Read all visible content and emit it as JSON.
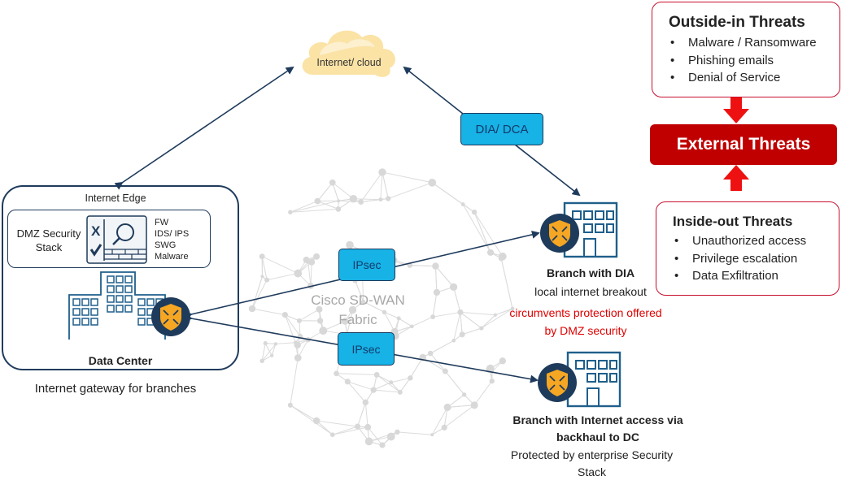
{
  "cloud": {
    "label": "Internet/ cloud"
  },
  "dia_dca": {
    "label": "DIA/ DCA"
  },
  "data_center": {
    "edge_label": "Internet Edge",
    "dmz_label_line1": "DMZ Security",
    "dmz_label_line2": "Stack",
    "stack_items": [
      "FW",
      "IDS/ IPS",
      "SWG",
      "Malware"
    ],
    "title": "Data Center",
    "caption": "Internet gateway for branches"
  },
  "fabric": {
    "line1": "Cisco SD-WAN",
    "line2": "Fabric"
  },
  "tunnels": [
    {
      "label": "IPsec"
    },
    {
      "label": "IPsec"
    }
  ],
  "branch_dia": {
    "title": "Branch with DIA",
    "line1": "local internet breakout",
    "warning_line1": "circumvents protection offered",
    "warning_line2": "by DMZ security"
  },
  "branch_backhaul": {
    "title_line1": "Branch with Internet access via",
    "title_line2": "backhaul to DC",
    "line1": "Protected by enterprise Security",
    "line2": "Stack"
  },
  "threats": {
    "outside_in": {
      "title": "Outside-in Threats",
      "items": [
        "Malware / Ransomware",
        "Phishing emails",
        "Denial of Service"
      ]
    },
    "external": {
      "label": "External Threats"
    },
    "inside_out": {
      "title": "Inside-out Threats",
      "items": [
        "Unauthorized access",
        "Privilege escalation",
        "Data Exfiltration"
      ]
    }
  },
  "colors": {
    "navy": "#1f3b5c",
    "router_orange": "#f5a623",
    "ipsec_blue": "#17b2e6",
    "threat_red": "#c00000",
    "warning_red": "#e00000",
    "cloud_yellow": "#fbe3a6"
  }
}
